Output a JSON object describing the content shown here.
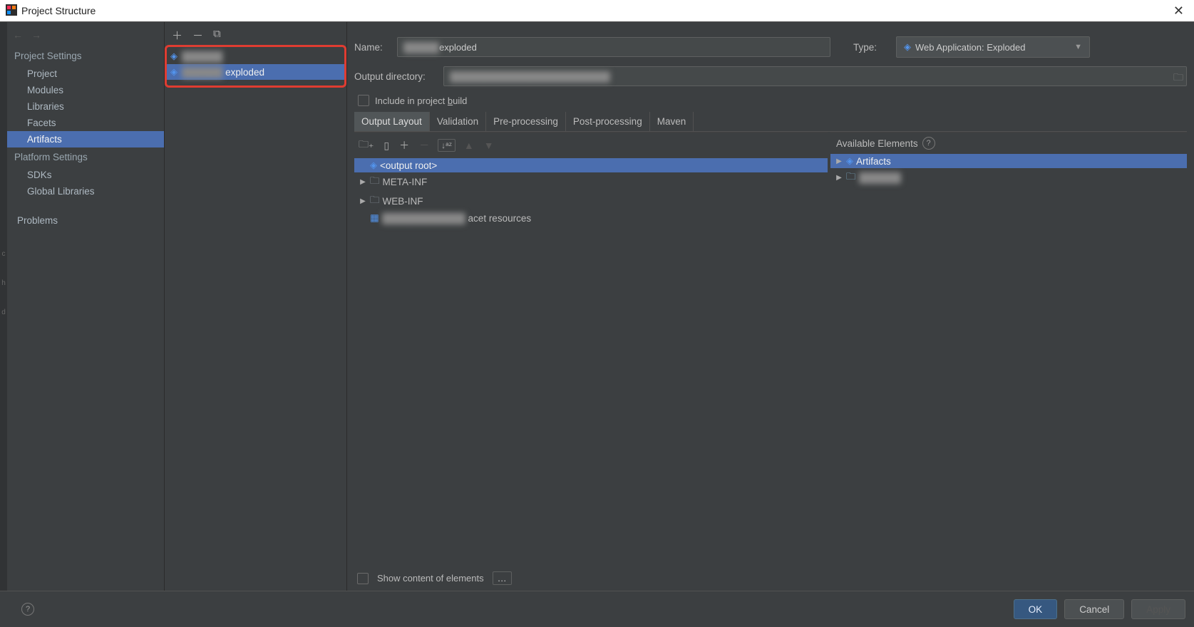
{
  "window": {
    "title": "Project Structure"
  },
  "sidebar": {
    "section1_title": "Project Settings",
    "items1": [
      "Project",
      "Modules",
      "Libraries",
      "Facets",
      "Artifacts"
    ],
    "selected1": "Artifacts",
    "section2_title": "Platform Settings",
    "items2": [
      "SDKs",
      "Global Libraries"
    ],
    "problems": "Problems"
  },
  "artifacts": {
    "list": [
      {
        "name_redacted": "██████",
        "suffix": ""
      },
      {
        "name_redacted": "██████",
        "suffix": "exploded"
      }
    ],
    "selected_index": 1
  },
  "details": {
    "name_label": "Name:",
    "name_redacted": "█████",
    "name_suffix": "exploded",
    "type_label": "Type:",
    "type_value": "Web Application: Exploded",
    "out_label": "Output directory:",
    "out_redacted": "████████████████████████",
    "include_label_pre": "Include in project ",
    "include_label_u": "b",
    "include_label_post": "uild",
    "tabs": [
      "Output Layout",
      "Validation",
      "Pre-processing",
      "Post-processing",
      "Maven"
    ],
    "active_tab": "Output Layout",
    "tree": {
      "root": "<output root>",
      "meta_inf": "META-INF",
      "web_inf": "WEB-INF",
      "facet_redacted": "████████████",
      "facet_suffix": "acet resources"
    },
    "available_title": "Available Elements",
    "available": {
      "artifacts": "Artifacts",
      "second_redacted": "██████"
    },
    "show_content": "Show content of elements"
  },
  "footer": {
    "ok": "OK",
    "cancel": "Cancel",
    "apply": "Apply"
  }
}
